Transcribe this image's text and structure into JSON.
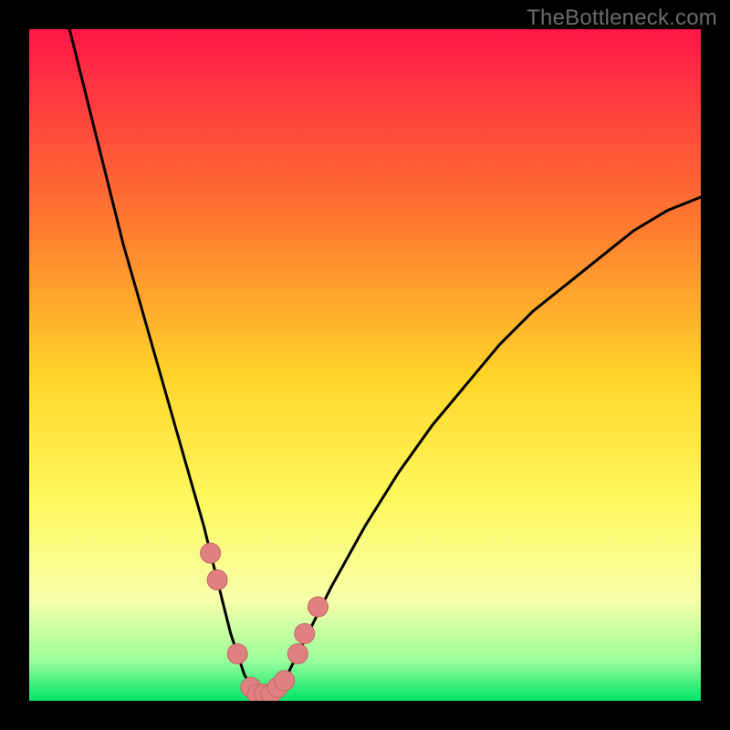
{
  "watermark": "TheBottleneck.com",
  "colors": {
    "frame": "#000000",
    "gradient_top": "#fe1647",
    "gradient_mid1": "#ff7e2f",
    "gradient_mid2": "#ffd62a",
    "gradient_mid3": "#fff95e",
    "gradient_low1": "#f7ffaa",
    "gradient_low2": "#9bff9b",
    "gradient_bottom": "#00e46a",
    "curve": "#000000",
    "marker_fill": "#e08080",
    "marker_stroke": "#c06868"
  },
  "chart_data": {
    "type": "line",
    "title": "",
    "xlabel": "",
    "ylabel": "",
    "xlim": [
      0,
      100
    ],
    "ylim": [
      0,
      100
    ],
    "series": [
      {
        "name": "bottleneck-curve",
        "x": [
          6,
          8,
          10,
          12,
          14,
          16,
          18,
          20,
          22,
          24,
          26,
          27,
          28,
          29,
          30,
          31,
          32,
          33,
          34,
          35,
          36,
          37,
          38,
          39,
          40,
          42,
          45,
          50,
          55,
          60,
          65,
          70,
          75,
          80,
          85,
          90,
          95,
          100
        ],
        "y": [
          100,
          92,
          84,
          76,
          68,
          61,
          54,
          47,
          40,
          33,
          26,
          22,
          18,
          14,
          10,
          7,
          4,
          2,
          1,
          1,
          1,
          2,
          3,
          5,
          7,
          11,
          17,
          26,
          34,
          41,
          47,
          53,
          58,
          62,
          66,
          70,
          73,
          75
        ]
      }
    ],
    "markers": [
      {
        "x": 27,
        "y": 22
      },
      {
        "x": 28,
        "y": 18
      },
      {
        "x": 31,
        "y": 7
      },
      {
        "x": 33,
        "y": 2
      },
      {
        "x": 34,
        "y": 1
      },
      {
        "x": 35,
        "y": 1
      },
      {
        "x": 36,
        "y": 1
      },
      {
        "x": 37,
        "y": 2
      },
      {
        "x": 38,
        "y": 3
      },
      {
        "x": 40,
        "y": 7
      },
      {
        "x": 41,
        "y": 10
      },
      {
        "x": 43,
        "y": 14
      }
    ]
  }
}
